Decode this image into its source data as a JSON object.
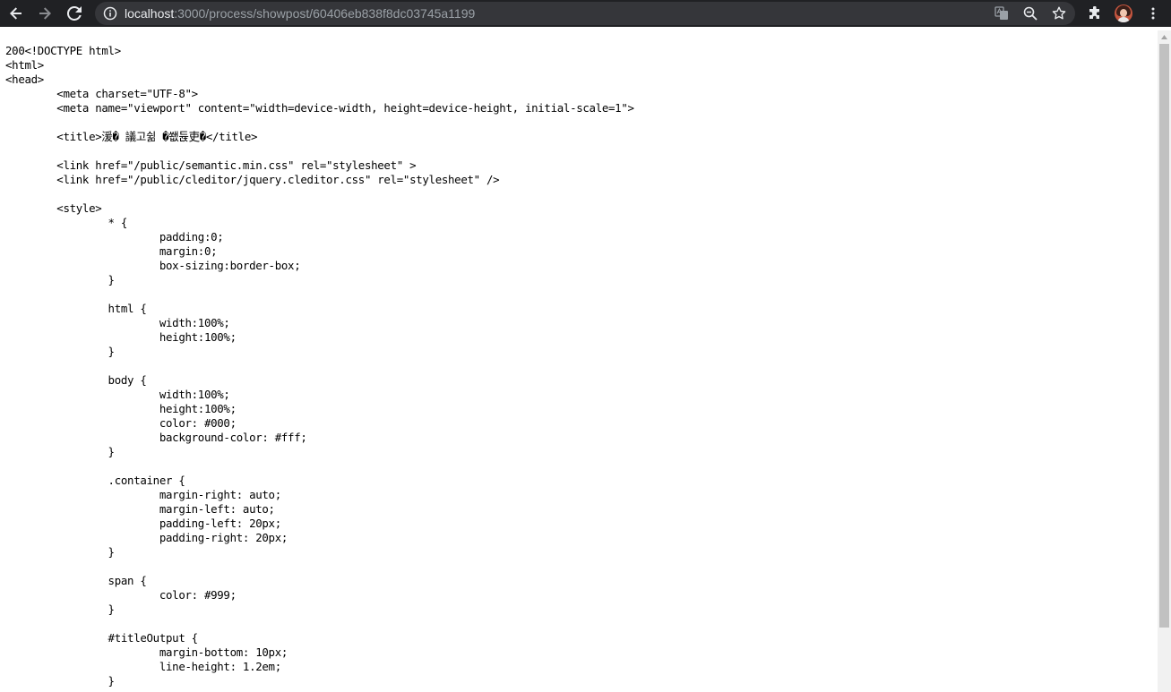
{
  "browser": {
    "url_host": "localhost",
    "url_path": ":3000/process/showpost/60406eb838f8dc03745a1199",
    "icons": {
      "back": "back-arrow-icon",
      "forward": "forward-arrow-icon",
      "reload": "reload-icon",
      "site_info": "info-icon",
      "translate": "translate-icon",
      "zoom": "zoom-icon",
      "bookmark": "star-icon",
      "extensions": "puzzle-icon",
      "profile": "avatar",
      "menu": "kebab-menu-icon"
    }
  },
  "page": {
    "source_text": "200<!DOCTYPE html>\n<html>\n<head>\n        <meta charset=\"UTF-8\">\n        <meta name=\"viewport\" content=\"width=device-width, height=device-height, initial-scale=1\">\n\n        <title>湲� 議고쉶 �쐢듅吏�</title>\n\n        <link href=\"/public/semantic.min.css\" rel=\"stylesheet\" >\n        <link href=\"/public/cleditor/jquery.cleditor.css\" rel=\"stylesheet\" />\n\n        <style>\n                * {\n                        padding:0;\n                        margin:0;\n                        box-sizing:border-box;\n                }\n\n                html {\n                        width:100%;\n                        height:100%;\n                }\n\n                body {\n                        width:100%;\n                        height:100%;\n                        color: #000;\n                        background-color: #fff;\n                }\n\n                .container {\n                        margin-right: auto;\n                        margin-left: auto;\n                        padding-left: 20px;\n                        padding-right: 20px;\n                }\n\n                span {\n                        color: #999;\n                }\n\n                #titleOutput {\n                        margin-bottom: 10px;\n                        line-height: 1.2em;\n                }"
  },
  "colors": {
    "toolbar_bg": "#202124",
    "omnibox_bg": "#35363a",
    "url_host": "#e8eaed",
    "url_path": "#9aa0a6",
    "scrollbar_thumb": "#c1c1c1"
  }
}
